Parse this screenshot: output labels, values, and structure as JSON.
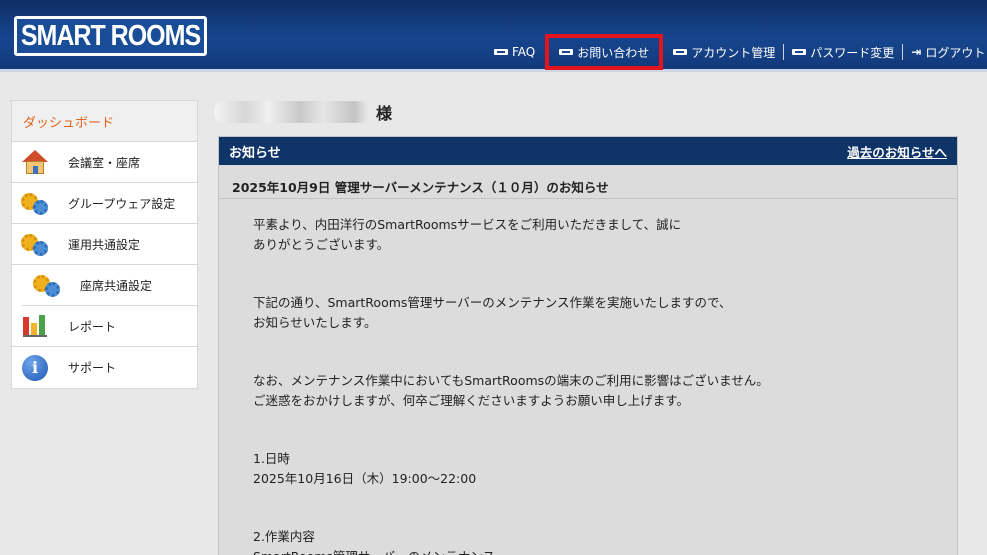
{
  "header": {
    "logo_text": "SMART ROOMS",
    "nav": {
      "faq": "FAQ",
      "contact": "お問い合わせ",
      "account": "アカウント管理",
      "password": "パスワード変更",
      "logout": "ログアウト"
    }
  },
  "sidebar": {
    "dashboard": "ダッシュボード",
    "items": [
      {
        "label": "会議室・座席"
      },
      {
        "label": "グループウェア設定"
      },
      {
        "label": "運用共通設定"
      },
      {
        "label": "座席共通設定"
      },
      {
        "label": "レポート"
      },
      {
        "label": "サポート"
      }
    ]
  },
  "main": {
    "honorific": "様",
    "notice_panel": {
      "title": "お知らせ",
      "past_link": "過去のお知らせへ",
      "notice_title": "2025年10月9日 管理サーバーメンテナンス（１０月）のお知らせ",
      "lines": [
        "平素より、内田洋行のSmartRoomsサービスをご利用いただきまして、誠に",
        "ありがとうございます。",
        "",
        "",
        "下記の通り、SmartRooms管理サーバーのメンテナンス作業を実施いたしますので、",
        "お知らせいたします。",
        "",
        "",
        "なお、メンテナンス作業中においてもSmartRoomsの端末のご利用に影響はございません。",
        "ご迷惑をおかけしますが、何卒ご理解くださいますようお願い申し上げます。",
        "",
        "",
        "1.日時",
        "2025年10月16日（木）19:00～22:00",
        "",
        "",
        "2.作業内容",
        "SmartRooms管理サーバーのメンテナンス"
      ]
    }
  },
  "colors": {
    "header_bg": "#17458e",
    "panel_head": "#0f3467",
    "highlight": "#e4141c",
    "dashboard_text": "#e0651a"
  }
}
